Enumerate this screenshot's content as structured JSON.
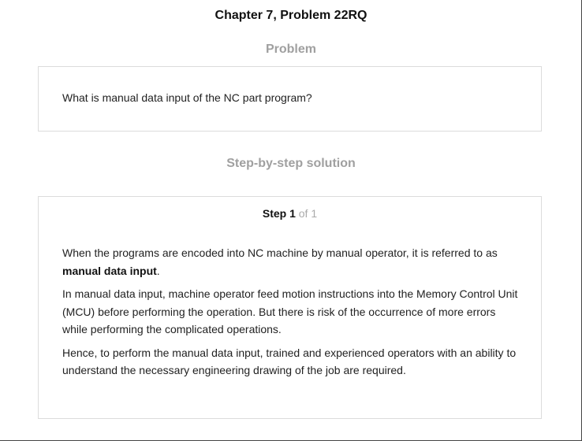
{
  "header": {
    "chapter_title": "Chapter 7, Problem 22RQ"
  },
  "problem": {
    "heading": "Problem",
    "text": "What is manual data input of the NC part program?"
  },
  "solution": {
    "heading": "Step-by-step solution",
    "step_word": "Step 1",
    "step_of": "of 1",
    "paragraph1_before": "When the programs are encoded into NC machine by manual operator, it is referred to as ",
    "paragraph1_bold": "manual data input",
    "paragraph1_after": ".",
    "paragraph2": "In manual data input, machine operator feed motion instructions into the Memory Control Unit (MCU) before performing the operation. But there is risk of the occurrence of more errors while performing the complicated operations.",
    "paragraph3": "Hence, to perform the manual data input, trained and experienced operators with an ability to understand the necessary engineering drawing of the job are required."
  }
}
